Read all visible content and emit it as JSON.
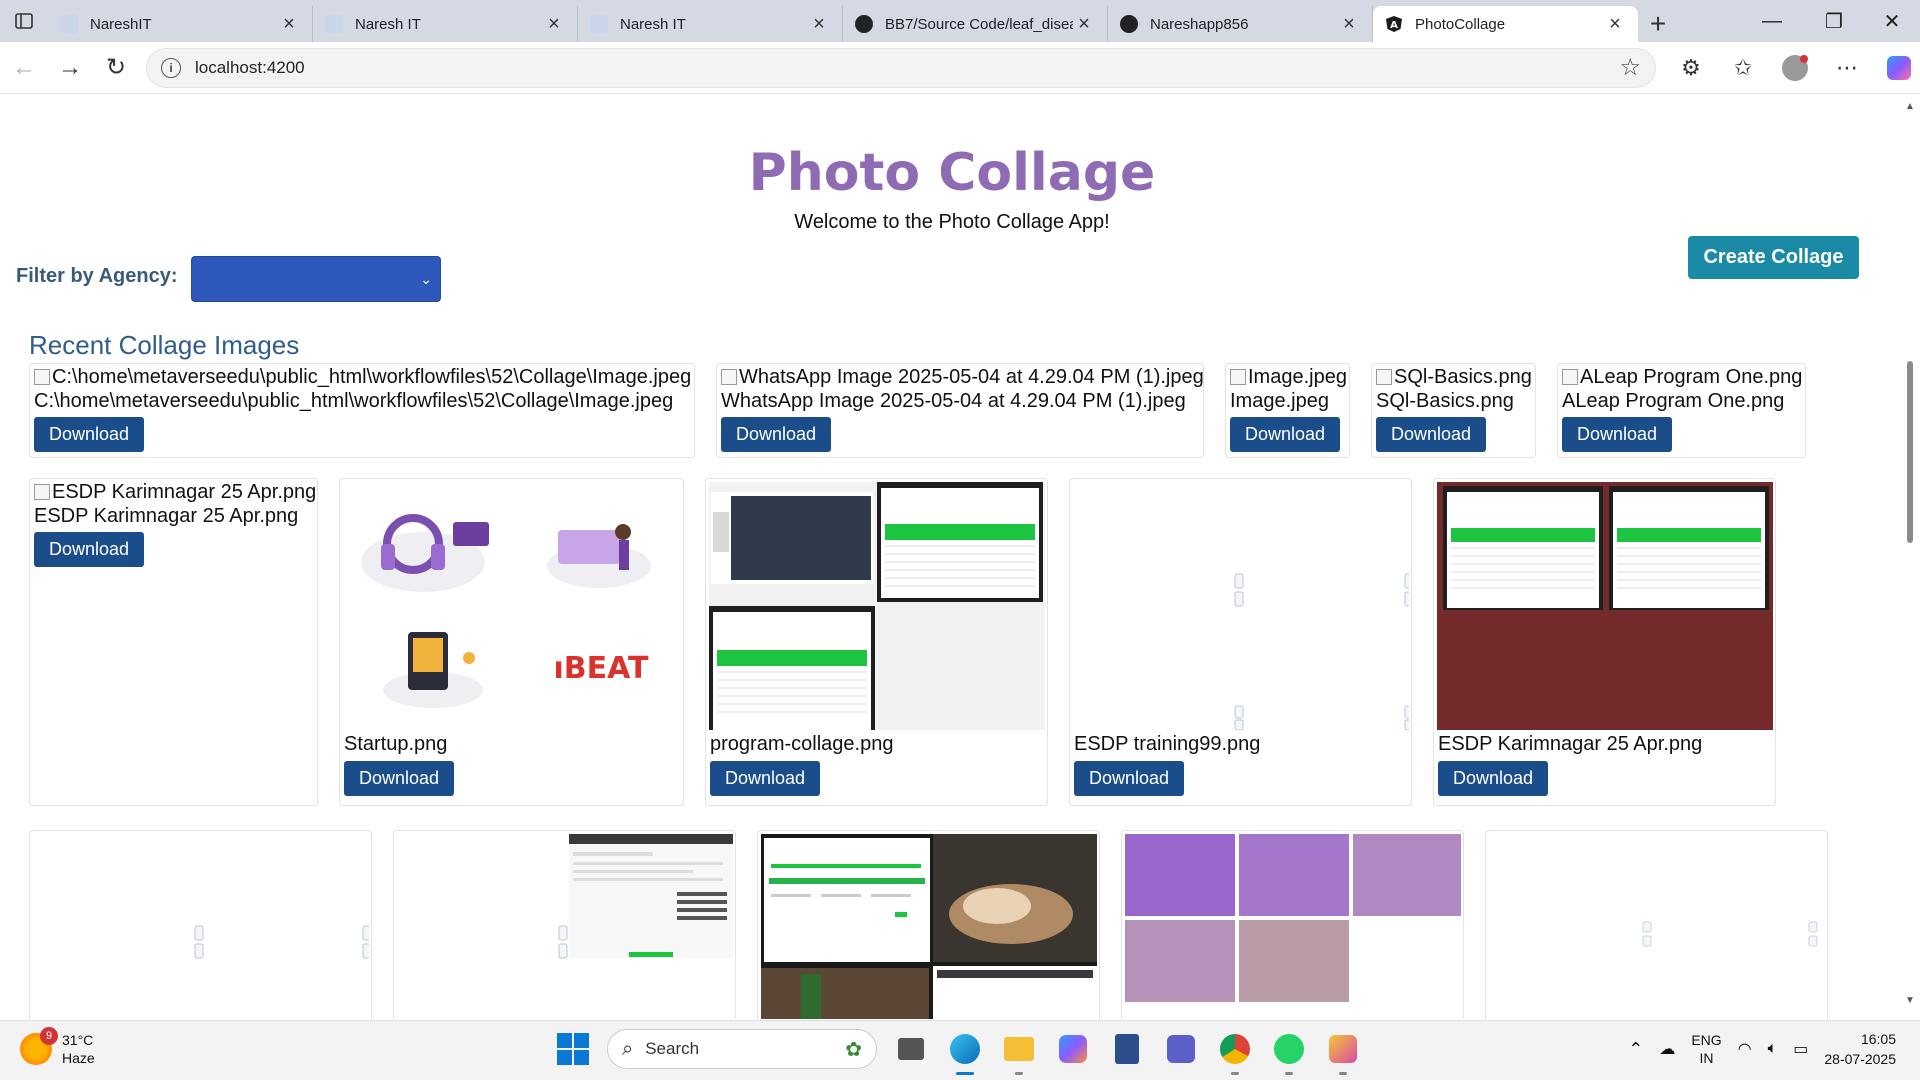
{
  "browser": {
    "tabs": [
      {
        "title": "NareshIT",
        "favicon": "naresh-favicon",
        "active": false
      },
      {
        "title": "Naresh IT",
        "favicon": "naresh-favicon",
        "active": false
      },
      {
        "title": "Naresh IT",
        "favicon": "naresh-favicon",
        "active": false
      },
      {
        "title": "BB7/Source Code/leaf_disea",
        "favicon": "github-icon",
        "active": false
      },
      {
        "title": "Nareshapp856",
        "favicon": "github-icon",
        "active": false
      },
      {
        "title": "PhotoCollage",
        "favicon": "angular-icon",
        "active": true
      }
    ],
    "url": "localhost:4200"
  },
  "page": {
    "title": "Photo Collage",
    "welcome": "Welcome to the Photo Collage App!",
    "filter_label": "Filter by Agency:",
    "filter_value": "",
    "create_button": "Create Collage",
    "section_title": "Recent Collage Images",
    "download_label": "Download",
    "row1": [
      {
        "alt": "C:\\home\\metaverseedu\\public_html\\workflowfiles\\52\\Collage\\Image.jpeg",
        "caption": "C:\\home\\metaverseedu\\public_html\\workflowfiles\\52\\Collage\\Image.jpeg"
      },
      {
        "alt": "WhatsApp Image 2025-05-04 at 4.29.04 PM (1).jpeg",
        "caption": "WhatsApp Image 2025-05-04 at 4.29.04 PM (1).jpeg"
      },
      {
        "alt": "Image.jpeg",
        "caption": "Image.jpeg"
      },
      {
        "alt": "SQl-Basics.png",
        "caption": "SQl-Basics.png"
      },
      {
        "alt": "ALeap Program One.png",
        "caption": "ALeap Program One.png"
      }
    ],
    "row2": [
      {
        "alt": "ESDP Karimnagar 25 Apr.png",
        "caption": "ESDP Karimnagar 25 Apr.png"
      },
      {
        "caption": "Startup.png"
      },
      {
        "caption": "program-collage.png"
      },
      {
        "caption": "ESDP training99.png"
      },
      {
        "caption": "ESDP Karimnagar 25 Apr.png"
      }
    ],
    "row3_tile_labels": [
      "",
      "",
      "",
      "",
      ""
    ]
  },
  "taskbar": {
    "weather_temp": "31°C",
    "weather_desc": "Haze",
    "weather_badge": "9",
    "search_placeholder": "Search",
    "lang_top": "ENG",
    "lang_bottom": "IN",
    "time": "16:05",
    "date": "28-07-2025"
  },
  "colors": {
    "title": "#8e6bb2",
    "create_button": "#1a8aa6",
    "download_button": "#1a4d8a",
    "filter_select": "#2f58bd"
  }
}
